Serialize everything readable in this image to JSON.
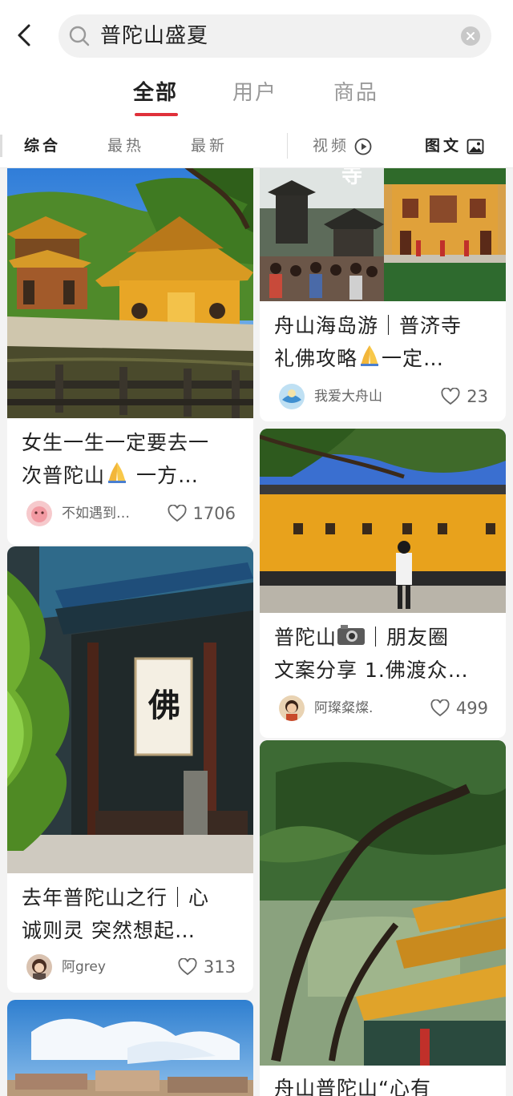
{
  "search": {
    "query": "普陀山盛夏"
  },
  "tabs": [
    {
      "label": "全部",
      "active": true
    },
    {
      "label": "用户",
      "active": false
    },
    {
      "label": "商品",
      "active": false
    }
  ],
  "filters": {
    "comprehensive": "综合",
    "hottest": "最热",
    "newest": "最新",
    "video": "视频",
    "image_text": "图文"
  },
  "colors": {
    "accent": "#e0303a",
    "active_text": "#222222",
    "inactive_text": "#9a9a9a"
  },
  "posts": [
    {
      "title_line1": "女生一生一定要去一",
      "title_line2_pre": "次普陀山",
      "title_line2_post": " 一方…",
      "author": "不如遇到…",
      "likes": "1706",
      "avatar_icon": "pink-avatar"
    },
    {
      "title_line1": "舟山海岛游｜普济寺",
      "title_line2_pre": "礼佛攻略",
      "title_line2_post": "一定…",
      "author": "我爱大舟山",
      "likes": "23",
      "avatar_icon": "blue-avatar"
    },
    {
      "title_line1": "普陀山",
      "title_line1_post": "｜朋友圈",
      "title_line2": "文案分享 1.佛渡众…",
      "author": "阿璨粲燦.",
      "likes": "499",
      "avatar_icon": "portrait-avatar"
    },
    {
      "title_line1": "去年普陀山之行｜心",
      "title_line2": "诚则灵 突然想起…",
      "author": "阿grey",
      "likes": "313",
      "avatar_icon": "portrait-avatar"
    },
    {
      "title_line1": "舟山普陀山“心有"
    }
  ],
  "image_text": {
    "temple_placard": "佛",
    "temple_sign": "寺"
  }
}
